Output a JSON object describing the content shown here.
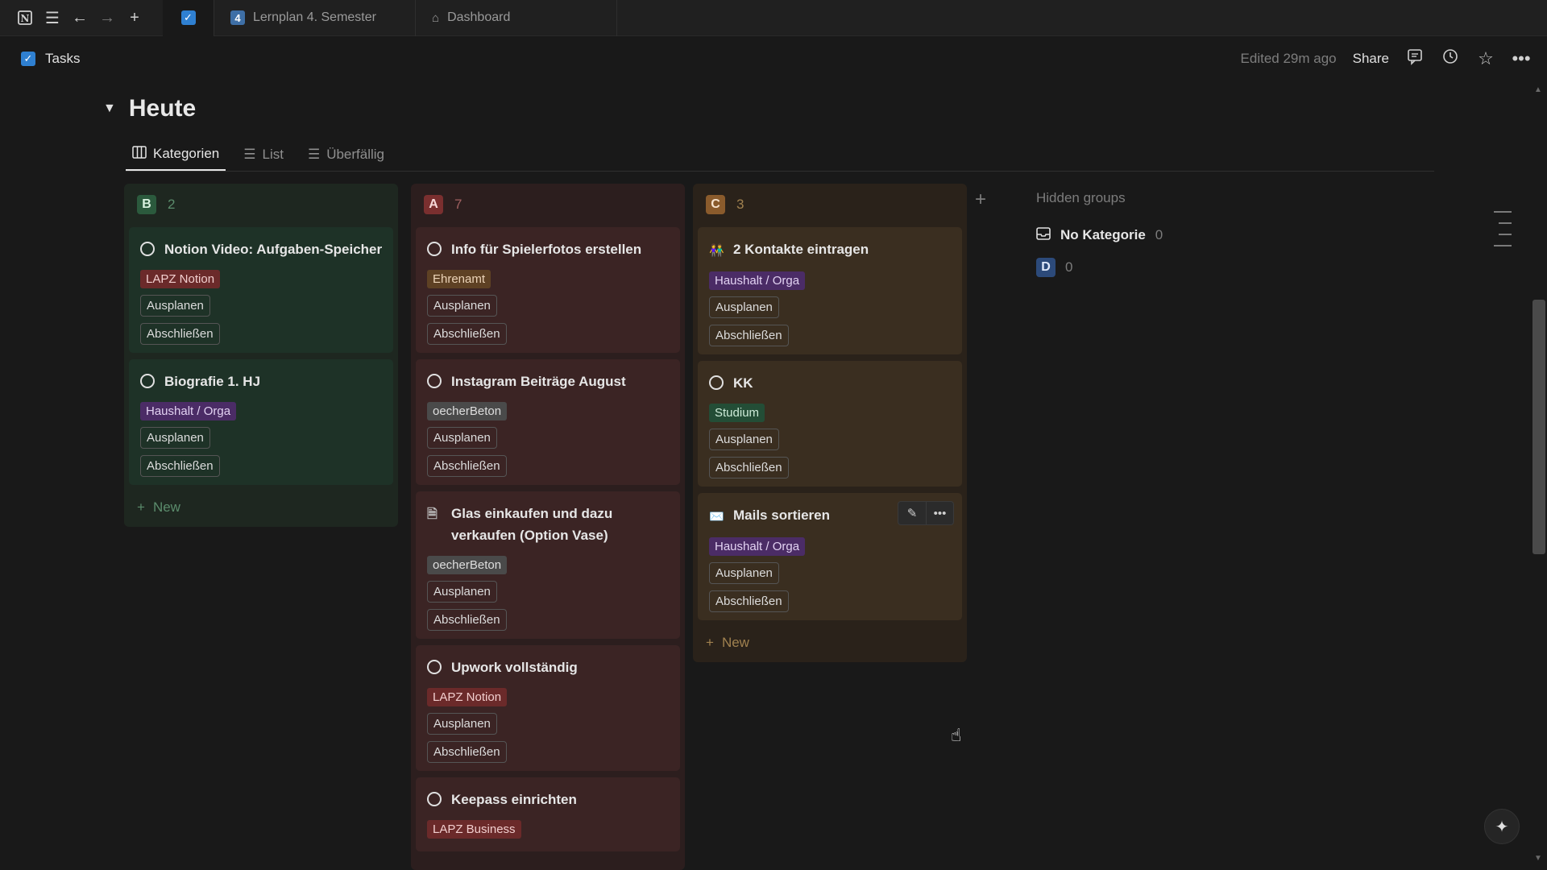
{
  "tabbar": {
    "icons": [
      "notion-logo-icon",
      "menu-icon",
      "back-arrow-icon",
      "forward-arrow-icon",
      "plus-icon"
    ],
    "tabs": [
      {
        "type": "checkbox-tab"
      },
      {
        "label": "Lernplan 4. Semester",
        "badge": "4"
      },
      {
        "label": "Dashboard"
      }
    ]
  },
  "topbar": {
    "page_title": "Tasks",
    "edited": "Edited 29m ago",
    "share": "Share"
  },
  "section": {
    "title": "Heute"
  },
  "views": [
    {
      "label": "Kategorien",
      "active": true
    },
    {
      "label": "List"
    },
    {
      "label": "Überfällig"
    }
  ],
  "columns": [
    {
      "group": "B",
      "count": "2",
      "new_label": "New",
      "cards": [
        {
          "title": "Notion Video: Aufgaben-Speicher",
          "tag": "LAPZ Notion",
          "btn1": "Ausplanen",
          "btn2": "Abschließen"
        },
        {
          "title": "Biografie 1. HJ",
          "tag": "Haushalt / Orga",
          "btn1": "Ausplanen",
          "btn2": "Abschließen"
        }
      ]
    },
    {
      "group": "A",
      "count": "7",
      "cards": [
        {
          "title": "Info für Spielerfotos erstellen",
          "tag": "Ehrenamt",
          "btn1": "Ausplanen",
          "btn2": "Abschließen"
        },
        {
          "title": "Instagram Beiträge August",
          "tag": "oecherBeton",
          "btn1": "Ausplanen",
          "btn2": "Abschließen"
        },
        {
          "title": "Glas einkaufen und dazu verkaufen (Option Vase)",
          "tag": "oecherBeton",
          "btn1": "Ausplanen",
          "btn2": "Abschließen"
        },
        {
          "title": "Upwork vollständig",
          "tag": "LAPZ Notion",
          "btn1": "Ausplanen",
          "btn2": "Abschließen"
        },
        {
          "title": "Keepass einrichten",
          "tag": "LAPZ Business"
        }
      ]
    },
    {
      "group": "C",
      "count": "3",
      "new_label": "New",
      "cards": [
        {
          "title": "2 Kontakte eintragen",
          "emoji": "👫",
          "tag": "Haushalt / Orga",
          "btn1": "Ausplanen",
          "btn2": "Abschließen"
        },
        {
          "title": "KK",
          "tag": "Studium",
          "btn1": "Ausplanen",
          "btn2": "Abschließen"
        },
        {
          "title": "Mails sortieren",
          "emoji": "✉️",
          "tag": "Haushalt / Orga",
          "btn1": "Ausplanen",
          "btn2": "Abschließen"
        }
      ]
    }
  ],
  "hidden_groups": {
    "title": "Hidden groups",
    "items": [
      {
        "label": "No Kategorie",
        "count": "0"
      },
      {
        "label": "D",
        "count": "0"
      }
    ]
  },
  "colors": {
    "background": "#191919",
    "column_b": "#1e3227",
    "column_a": "#3b2424",
    "column_c": "#3a2e20"
  }
}
